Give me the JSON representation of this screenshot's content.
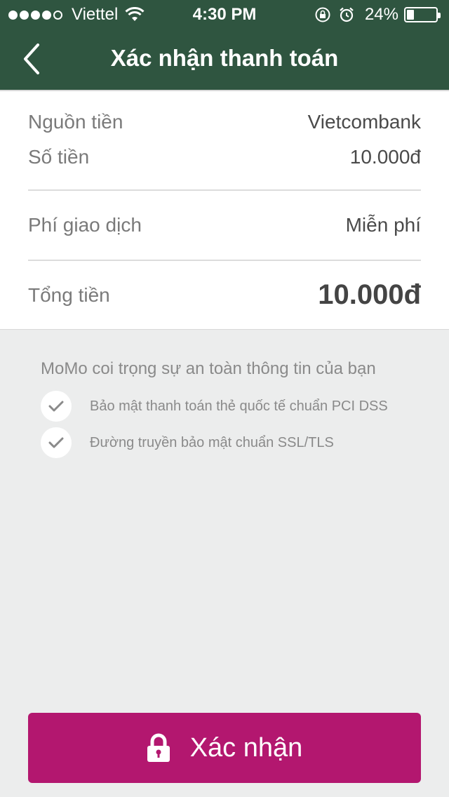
{
  "status_bar": {
    "carrier": "Viettel",
    "time": "4:30 PM",
    "battery": "24%",
    "battery_level": 0.24,
    "signal_bars_filled": 4,
    "signal_bars_total": 5
  },
  "nav": {
    "title": "Xác nhận thanh toán",
    "back_icon": "chevron-left-icon"
  },
  "summary": {
    "source_label": "Nguồn tiền",
    "source_value": "Vietcombank",
    "amount_label": "Số tiền",
    "amount_value": "10.000đ",
    "fee_label": "Phí giao dịch",
    "fee_value": "Miễn phí",
    "total_label": "Tổng tiền",
    "total_value": "10.000đ"
  },
  "security": {
    "title": "MoMo coi trọng sự an toàn thông tin của bạn",
    "items": [
      "Bảo mật thanh toán thẻ quốc tế chuẩn PCI DSS",
      "Đường truyền bảo mật chuẩn SSL/TLS"
    ]
  },
  "confirm": {
    "label": "Xác nhận",
    "icon": "lock-icon"
  },
  "colors": {
    "header": "#2f5540",
    "button": "#b3176f",
    "background": "#eceded"
  }
}
